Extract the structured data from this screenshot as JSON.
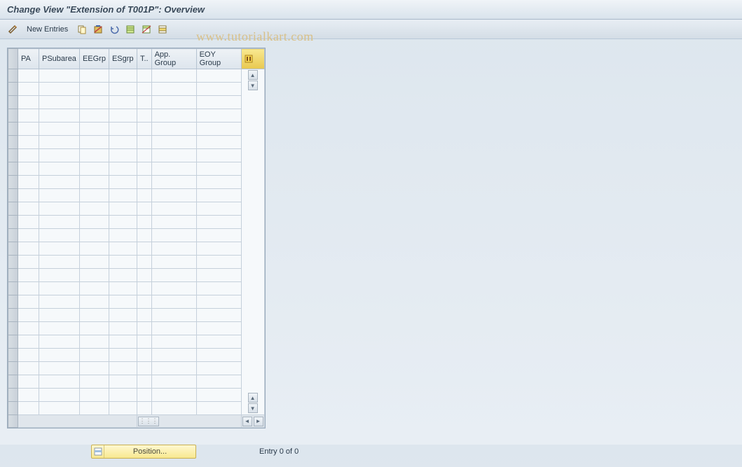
{
  "title": "Change View \"Extension of T001P\": Overview",
  "toolbar": {
    "new_entries_label": "New Entries"
  },
  "watermark": "www.tutorialkart.com",
  "table": {
    "columns": [
      "PA",
      "PSubarea",
      "EEGrp",
      "ESgrp",
      "T..",
      "App. Group",
      "EOY Group"
    ],
    "row_count": 26
  },
  "footer": {
    "position_label": "Position...",
    "entry_status": "Entry 0 of 0"
  }
}
